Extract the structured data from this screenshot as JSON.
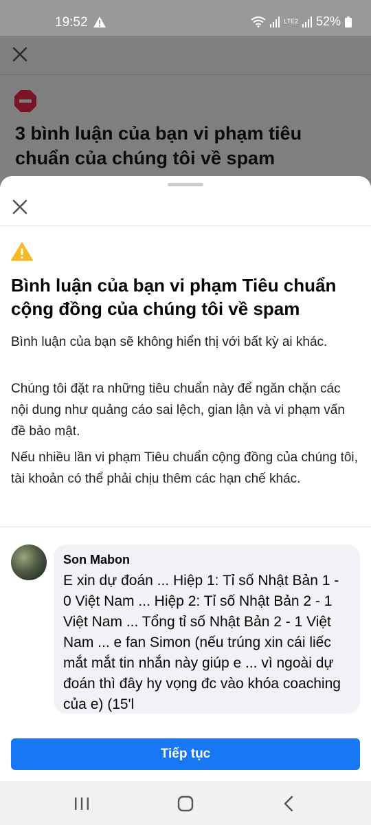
{
  "status_bar": {
    "time": "19:52",
    "network": "LTE2",
    "battery": "52%"
  },
  "background": {
    "title": "3 bình luận của bạn vi phạm tiêu chuẩn của chúng tôi về spam"
  },
  "sheet": {
    "title": "Bình luận của bạn vi phạm Tiêu chuẩn cộng đồng của chúng tôi về spam",
    "paragraphs": [
      "Bình luận của bạn sẽ không hiển thị với bất kỳ ai khác.",
      "Chúng tôi đặt ra những tiêu chuẩn này để ngăn chặn các nội dung như quảng cáo sai lệch, gian lận và vi phạm vấn đề bảo mật.",
      "Nếu nhiều lần vi phạm Tiêu chuẩn cộng đồng của chúng tôi, tài khoản có thể phải chịu thêm các hạn chế khác."
    ],
    "comment": {
      "author": "Son Mabon",
      "text": "E xin dự đoán ... Hiệp 1: Tỉ số Nhật Bản 1 - 0 Việt Nam ... Hiệp 2: Tỉ số Nhật Bản 2 - 1 Việt Nam ... Tổng tỉ số Nhật Bản 2 - 1 Việt Nam ... e fan Simon (nếu trúng xin cái liếc mắt mắt tin nhắn này giúp e ... vì ngoài dự đoán thì đây hy vọng đc vào khóa coaching của e) (15'l"
    },
    "continue_label": "Tiếp tục"
  },
  "icons": {
    "close": "close-icon",
    "warning": "warning-icon",
    "stop": "stop-icon",
    "nav_recents": "recents-icon",
    "nav_home": "home-icon",
    "nav_back": "back-icon"
  },
  "colors": {
    "primary": "#1877f2",
    "warning": "#f7b928",
    "stop": "#e41e3f",
    "bubble": "#f0f2f5"
  }
}
